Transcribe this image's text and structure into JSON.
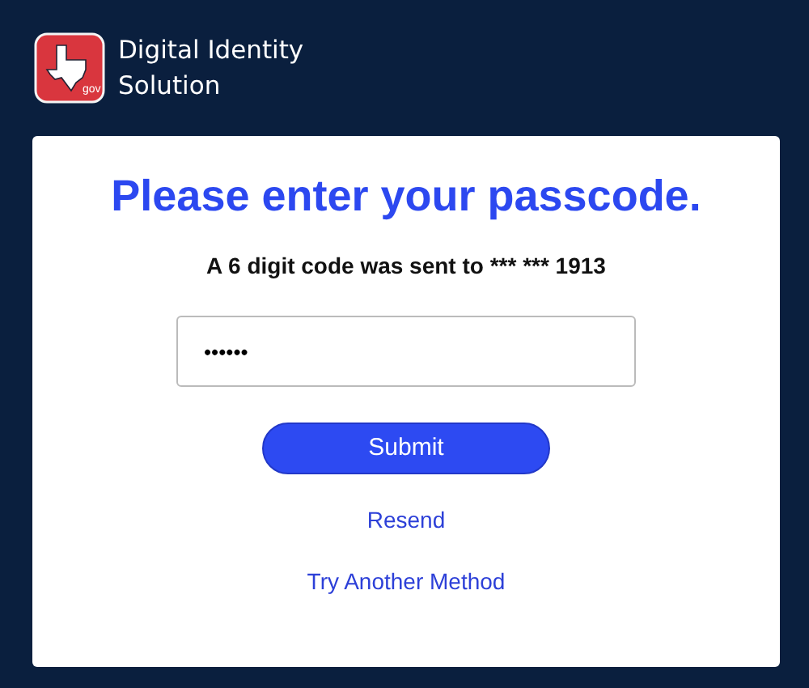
{
  "header": {
    "logo_text": "gov",
    "title": "Digital Identity Solution"
  },
  "card": {
    "title": "Please enter your passcode.",
    "message": "A 6 digit code was sent to *** *** 1913",
    "passcode_field": {
      "value": "••••••"
    },
    "submit_button": "Submit",
    "links": [
      "Resend",
      "Try Another Method"
    ]
  }
}
